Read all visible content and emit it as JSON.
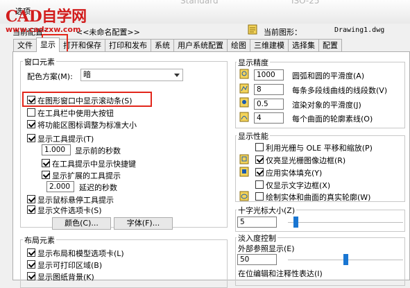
{
  "window": {
    "title": "选项",
    "bg_fragments": [
      "Standard",
      "ISO-25"
    ]
  },
  "watermark": {
    "logo": "CAD自学网",
    "url": "www.cadzxw.com"
  },
  "header": {
    "current_config_label": "当前配置：",
    "current_config_value": "<<未命名配置>>",
    "current_drawing_label": "当前图形：",
    "current_drawing_value": "Drawing1.dwg"
  },
  "tabs": [
    "文件",
    "显示",
    "打开和保存",
    "打印和发布",
    "系统",
    "用户系统配置",
    "绘图",
    "三维建模",
    "选择集",
    "配置"
  ],
  "window_elements": {
    "title": "窗口元素",
    "scheme_label": "配色方案(M):",
    "scheme_value": "暗",
    "options": [
      {
        "label": "在图形窗口中显示滚动条(S)",
        "checked": true
      },
      {
        "label": "在工具栏中使用大按钮",
        "checked": false
      },
      {
        "label": "将功能区图标调整为标准大小",
        "checked": true
      },
      {
        "label": "显示工具提示(T)",
        "checked": true
      }
    ],
    "tooltip_delay_value": "1.000",
    "tooltip_delay_label": "显示前的秒数",
    "sub_options": [
      {
        "label": "在工具提示中显示快捷键",
        "checked": true
      },
      {
        "label": "显示扩展的工具提示",
        "checked": true
      }
    ],
    "ext_delay_value": "2.000",
    "ext_delay_label": "延迟的秒数",
    "options2": [
      {
        "label": "显示鼠标悬停工具提示",
        "checked": true
      },
      {
        "label": "显示文件选项卡(S)",
        "checked": true
      }
    ],
    "colors_button": "颜色(C)...",
    "fonts_button": "字体(F)..."
  },
  "layout_elements": {
    "title": "布局元素",
    "options": [
      {
        "label": "显示布局和模型选项卡(L)",
        "checked": true
      },
      {
        "label": "显示可打印区域(B)",
        "checked": true
      },
      {
        "label": "显示图纸背景(K)",
        "checked": true
      }
    ]
  },
  "display_resolution": {
    "title": "显示精度",
    "rows": [
      {
        "value": "1000",
        "label": "圆弧和圆的平滑度(A)"
      },
      {
        "value": "8",
        "label": "每条多段线曲线的线段数(V)"
      },
      {
        "value": "0.5",
        "label": "渲染对象的平滑度(J)"
      },
      {
        "value": "4",
        "label": "每个曲面的轮廓素线(O)"
      }
    ]
  },
  "display_performance": {
    "title": "显示性能",
    "options": [
      {
        "label": "利用光栅与 OLE 平移和缩放(P)",
        "checked": false,
        "icon": false
      },
      {
        "label": "仅亮显光栅图像边框(R)",
        "checked": true,
        "icon": true
      },
      {
        "label": "应用实体填充(Y)",
        "checked": true,
        "icon": true
      },
      {
        "label": "仅显示文字边框(X)",
        "checked": false,
        "icon": false
      },
      {
        "label": "绘制实体和曲面的真实轮廓(W)",
        "checked": false,
        "icon": true
      }
    ]
  },
  "crosshair": {
    "title": "十字光标大小(Z)",
    "value": "5",
    "level_percent": 5
  },
  "fade": {
    "title": "淡入度控制",
    "xref_label": "外部参照显示(E)",
    "xref_value": "50",
    "xref_level_percent": 50,
    "inplace_label": "在位编辑和注释性表达(I)"
  },
  "colors": {
    "highlight": "#e2261b",
    "watermark": "#d21c1c",
    "slider": "#1976d2"
  }
}
